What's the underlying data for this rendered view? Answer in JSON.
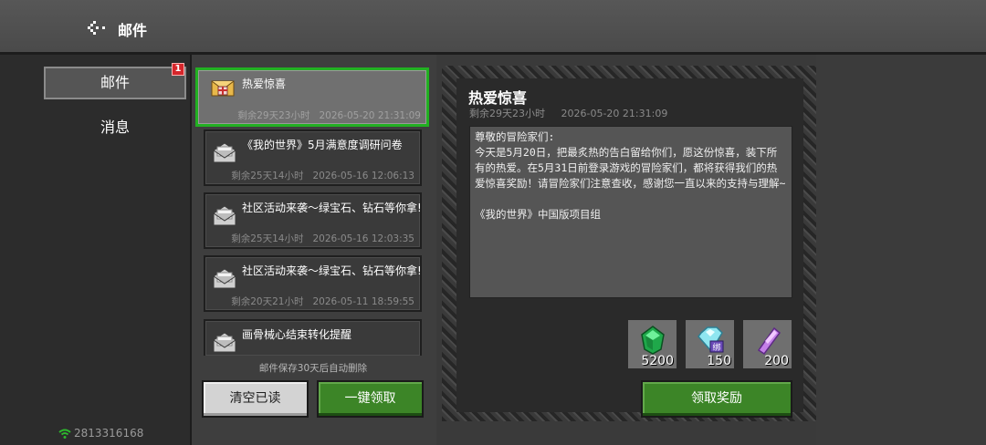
{
  "header": {
    "title": "邮件",
    "back_icon": "back-icon"
  },
  "nav": {
    "mail_label": "邮件",
    "mail_badge": "1",
    "messages_label": "消息"
  },
  "status": {
    "player_id": "2813316168",
    "wifi_icon": "wifi-icon"
  },
  "mail_list": {
    "items": [
      {
        "title": "热爱惊喜",
        "remaining": "剩余29天23小时",
        "date": "2026-05-20 21:31:09",
        "icon": "gift-envelope-icon",
        "selected": true
      },
      {
        "title": "《我的世界》5月满意度调研问卷",
        "remaining": "剩余25天14小时",
        "date": "2026-05-16 12:06:13",
        "icon": "open-envelope-icon"
      },
      {
        "title": "社区活动来袭～绿宝石、钻石等你拿!",
        "remaining": "剩余25天14小时",
        "date": "2026-05-16 12:03:35",
        "icon": "open-envelope-icon"
      },
      {
        "title": "社区活动来袭～绿宝石、钻石等你拿!",
        "remaining": "剩余20天21小时",
        "date": "2026-05-11 18:59:55",
        "icon": "open-envelope-icon"
      },
      {
        "title": "画骨械心结束转化提醒",
        "remaining": "",
        "date": "",
        "icon": "open-envelope-icon"
      }
    ],
    "retention_note": "邮件保存30天后自动删除",
    "clear_label": "清空已读",
    "collect_all_label": "一键领取"
  },
  "detail": {
    "title": "热爱惊喜",
    "remaining": "剩余29天23小时",
    "date": "2026-05-20 21:31:09",
    "body_lines": [
      "尊敬的冒险家们:",
      "今天是5月20日，把最炙热的告白留给你们，愿这份惊喜，装下所有的热爱。在5月31日前登录游戏的冒险家们，都将获得我们的热爱惊喜奖励！请冒险家们注意查收，感谢您一直以来的支持与理解~",
      "",
      "《我的世界》中国版项目组"
    ],
    "rewards": [
      {
        "icon": "emerald-icon",
        "count": "5200"
      },
      {
        "icon": "bound-diamond-icon",
        "count": "150",
        "tag": "绑"
      },
      {
        "icon": "amethyst-crystal-icon",
        "count": "200"
      }
    ],
    "claim_label": "领取奖励"
  },
  "colors": {
    "accent_green": "#3c8527",
    "selection_border": "#22b022",
    "badge_red": "#d6262b"
  }
}
